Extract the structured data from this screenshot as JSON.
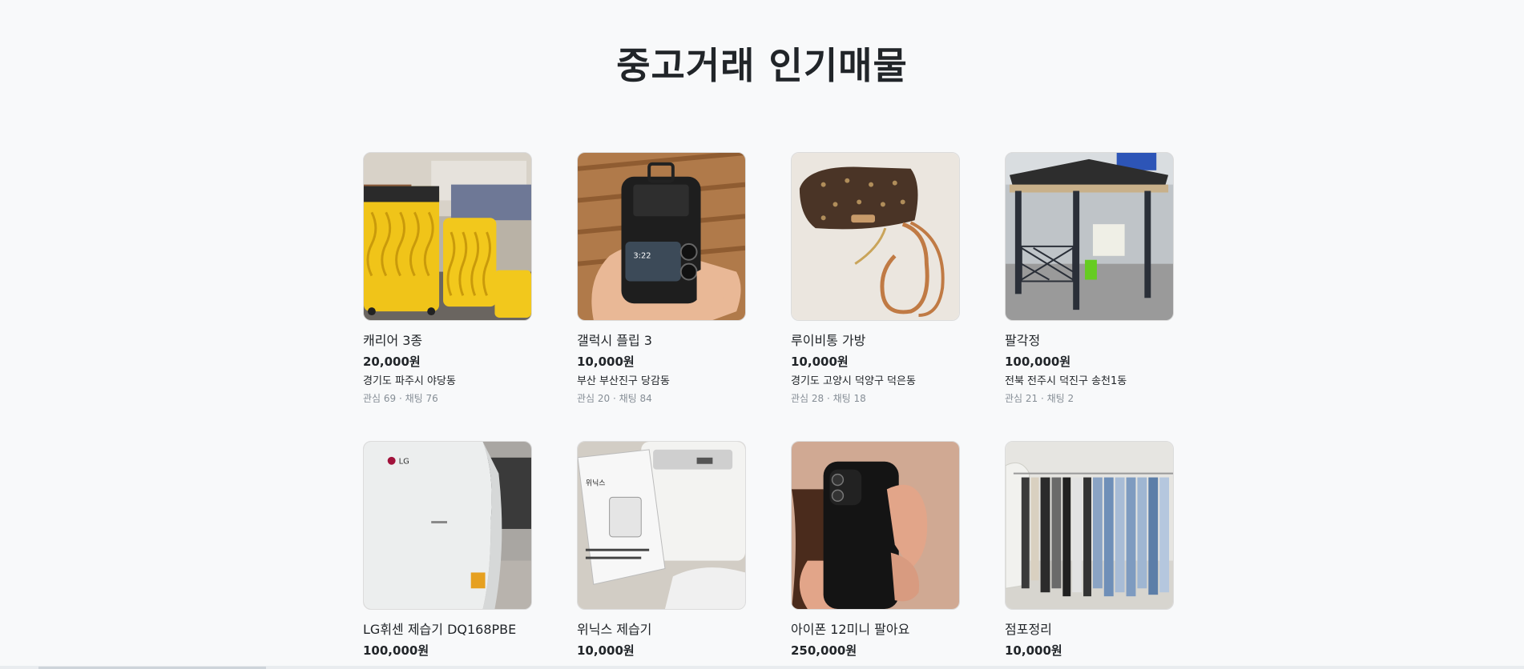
{
  "page": {
    "title": "중고거래 인기매물"
  },
  "products": [
    {
      "title": "캐리어 3종",
      "price": "20,000원",
      "region": "경기도 파주시 야당동",
      "counts": "관심 69 · 채팅 76",
      "image_icon": "suitcase-photo-icon"
    },
    {
      "title": "갤럭시 플립 3",
      "price": "10,000원",
      "region": "부산 부산진구 당감동",
      "counts": "관심 20 · 채팅 84",
      "image_icon": "phone-photo-icon"
    },
    {
      "title": "루이비통 가방",
      "price": "10,000원",
      "region": "경기도 고양시 덕양구 덕은동",
      "counts": "관심 28 · 채팅 18",
      "image_icon": "bag-photo-icon"
    },
    {
      "title": "팔각정",
      "price": "100,000원",
      "region": "전북 전주시 덕진구 송천1동",
      "counts": "관심 21 · 채팅 2",
      "image_icon": "pavilion-photo-icon"
    },
    {
      "title": "LG휘센 제습기 DQ168PBE",
      "price": "100,000원",
      "region": "",
      "counts": "",
      "image_icon": "dehumidifier-photo-icon"
    },
    {
      "title": "위닉스 제습기",
      "price": "10,000원",
      "region": "",
      "counts": "",
      "image_icon": "dehumidifier-box-photo-icon"
    },
    {
      "title": "아이폰 12미니 팔아요",
      "price": "250,000원",
      "region": "",
      "counts": "",
      "image_icon": "iphone-photo-icon"
    },
    {
      "title": "점포정리",
      "price": "10,000원",
      "region": "",
      "counts": "",
      "image_icon": "clothes-rack-photo-icon"
    }
  ]
}
